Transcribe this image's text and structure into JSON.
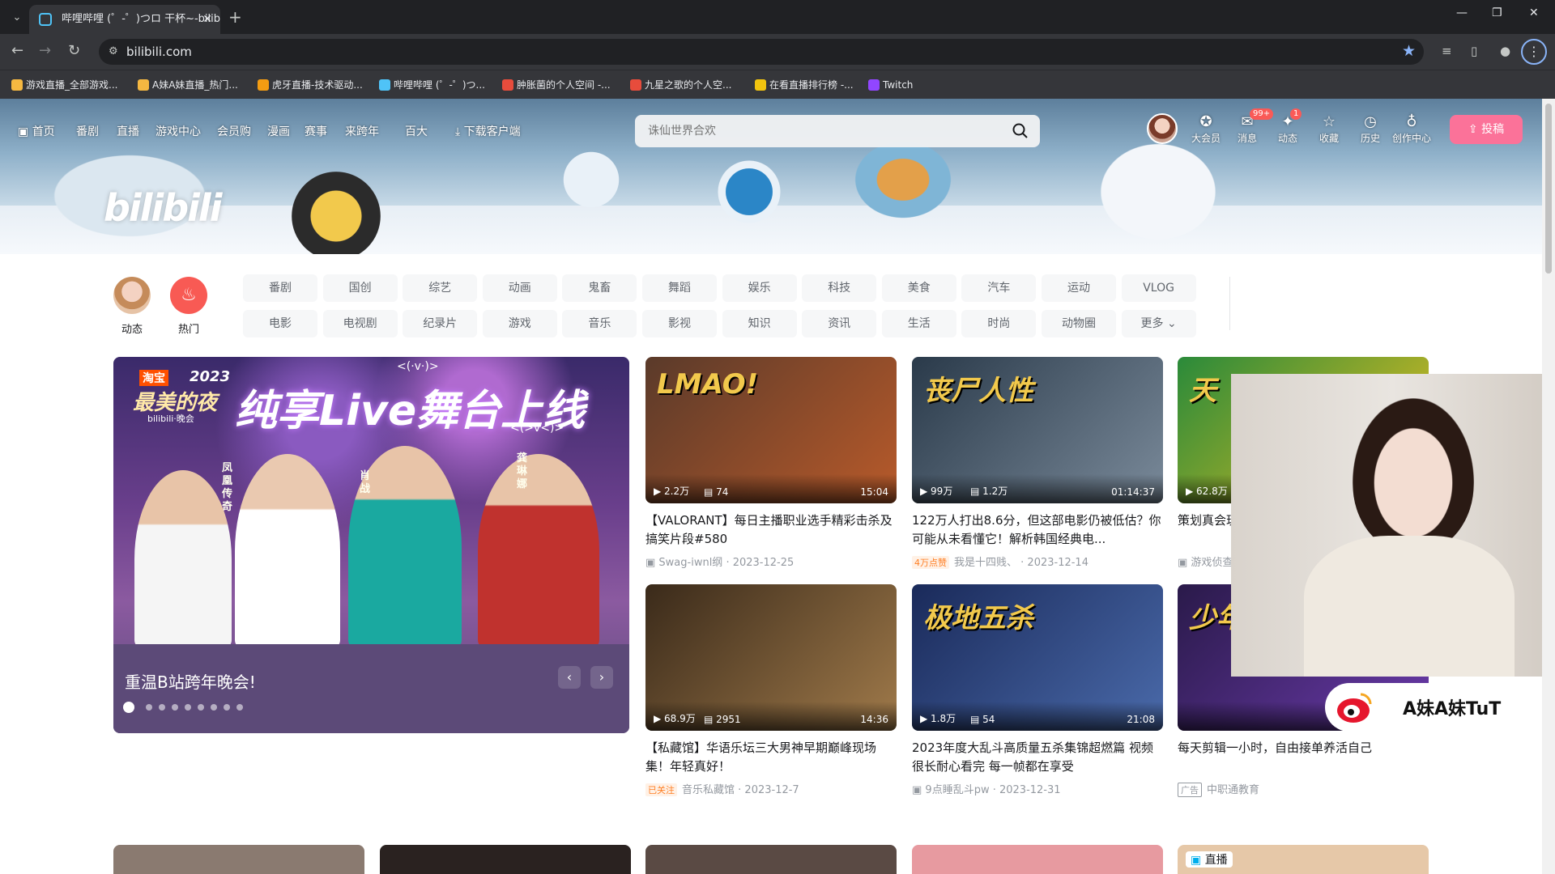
{
  "browser": {
    "tab_title": "哔哩哔哩 (゜-゜)つロ 干杯~-bilibili",
    "address": "bilibili.com",
    "bookmarks": [
      {
        "label": "游戏直播_全部游戏...",
        "color": "#f5b841"
      },
      {
        "label": "A妹A妹直播_热门...",
        "color": "#f5b841"
      },
      {
        "label": "虎牙直播-技术驱动...",
        "color": "#f39c12"
      },
      {
        "label": "哔哩哔哩 (゜-゜)つ...",
        "color": "#4fc3f7"
      },
      {
        "label": "肿胀菌的个人空间 -...",
        "color": "#e74c3c"
      },
      {
        "label": "九星之歌的个人空...",
        "color": "#e74c3c"
      },
      {
        "label": "在看直播排行榜 -...",
        "color": "#f1c40f"
      },
      {
        "label": "Twitch",
        "color": "#9146ff"
      }
    ]
  },
  "header": {
    "nav": [
      "首页",
      "番剧",
      "直播",
      "游戏中心",
      "会员购",
      "漫画",
      "赛事",
      "来跨年",
      "百大",
      "下载客户端"
    ],
    "search_placeholder": "诛仙世界合欢",
    "icons": [
      {
        "label": "大会员",
        "icon": "vip-icon"
      },
      {
        "label": "消息",
        "icon": "message-icon",
        "badge": "99+"
      },
      {
        "label": "动态",
        "icon": "dynamic-icon",
        "badge": "1"
      },
      {
        "label": "收藏",
        "icon": "favorite-icon"
      },
      {
        "label": "历史",
        "icon": "history-icon"
      },
      {
        "label": "创作中心",
        "icon": "creator-icon"
      }
    ],
    "upload_label": "投稿",
    "logo_text": "bilibili"
  },
  "channels": {
    "dynamic_label": "动态",
    "hot_label": "热门",
    "row1": [
      "番剧",
      "国创",
      "综艺",
      "动画",
      "鬼畜",
      "舞蹈",
      "娱乐",
      "科技",
      "美食",
      "汽车",
      "运动",
      "VLOG"
    ],
    "row2": [
      "电影",
      "电视剧",
      "纪录片",
      "游戏",
      "音乐",
      "影视",
      "知识",
      "资讯",
      "生活",
      "时尚",
      "动物圈",
      "更多"
    ]
  },
  "carousel": {
    "caption": "重温B站跨年晚会!",
    "poster_headline": "纯享Live舞台上线",
    "poster_brand": "淘宝",
    "poster_year": "2023",
    "poster_sub": "最美的夜",
    "poster_brand2": "bilibili·晚会",
    "poster_emote": "<(·v·)>",
    "poster_emote2": "<(>v<)>",
    "names": [
      "凤凰传奇",
      "肖战",
      "龚琳娜"
    ],
    "dots": 9,
    "active_dot": 0
  },
  "videos": [
    {
      "title": "【VALORANT】每日主播职业选手精彩击杀及搞笑片段#580",
      "views": "2.2万",
      "danmaku": "74",
      "duration": "15:04",
      "author": "Swag-iwnl纲",
      "date": "2023-12-25",
      "tag": "",
      "thumb_text": "LMAO!",
      "c1": "#5a3a2a",
      "c2": "#b85a2a"
    },
    {
      "title": "122万人打出8.6分，但这部电影仍被低估？你可能从未看懂它！解析韩国经典电...",
      "views": "99万",
      "danmaku": "1.2万",
      "duration": "01:14:37",
      "author": "我是十四贱、",
      "date": "2023-12-14",
      "tag": "4万点赞",
      "thumb_text": "丧尸人性",
      "c1": "#2a3a4a",
      "c2": "#7a8a9a"
    },
    {
      "title": "策划真会玩 老玩家回...",
      "views": "62.8万",
      "danmaku": "",
      "duration": "",
      "author": "游戏侦查",
      "date": "",
      "tag": "",
      "thumb_text": "天",
      "c1": "#2a8a3a",
      "c2": "#e8c020"
    },
    {
      "title": "【私藏馆】华语乐坛三大男神早期巅峰现场集！年轻真好！",
      "views": "68.9万",
      "danmaku": "2951",
      "duration": "14:36",
      "author": "音乐私藏馆",
      "date": "2023-12-7",
      "tag": "已关注",
      "thumb_text": "",
      "c1": "#3a2a1a",
      "c2": "#a07a4a"
    },
    {
      "title": "2023年度大乱斗高质量五杀集锦超燃篇 视频很长耐心看完 每一帧都在享受",
      "views": "1.8万",
      "danmaku": "54",
      "duration": "21:08",
      "author": "9点睡乱斗pw",
      "date": "2023-12-31",
      "tag": "",
      "thumb_text": "极地五杀",
      "c1": "#1a2a5a",
      "c2": "#4a6aaa"
    },
    {
      "title": "每天剪辑一小时，自由接单养活自己",
      "views": "",
      "danmaku": "",
      "duration": "",
      "author": "中职通教育",
      "date": "",
      "tag": "广告",
      "thumb_text": "少年，来剪辑",
      "c1": "#2a1a4a",
      "c2": "#6a3aaa"
    }
  ],
  "bottom_row": {
    "live_label": "直播"
  },
  "overlay": {
    "streamer_name": "A妹A妹TuT",
    "weibo_icon": "weibo-icon"
  },
  "colors": {
    "accent": "#fb7299",
    "text": "#18191c",
    "sub": "#9499a0",
    "bili_blue": "#00aeec"
  }
}
